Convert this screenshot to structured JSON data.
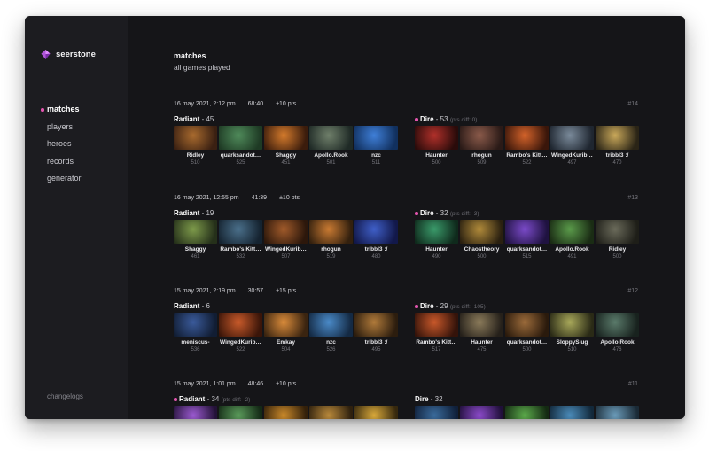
{
  "app": {
    "name": "seerstone",
    "logo": "gem-icon",
    "accent": "#e255ae"
  },
  "sidebar": {
    "items": [
      {
        "label": "matches",
        "active": true
      },
      {
        "label": "players",
        "active": false
      },
      {
        "label": "heroes",
        "active": false
      },
      {
        "label": "records",
        "active": false
      },
      {
        "label": "generator",
        "active": false
      }
    ],
    "footer": "changelogs"
  },
  "page": {
    "title": "matches",
    "subtitle": "all games played"
  },
  "matches": [
    {
      "date": "16 may 2021, 2:12 pm",
      "duration": "68:40",
      "pts": "±10 pts",
      "id": "#14",
      "radiant": {
        "name": "Radiant",
        "score": " - 45",
        "diff": "",
        "winner": false,
        "players": [
          {
            "name": "Ridley",
            "points": "510",
            "hero_colors": [
              "#a86a2e",
              "#3a2012"
            ]
          },
          {
            "name": "quarksandot…",
            "points": "525",
            "hero_colors": [
              "#4f8a5a",
              "#1e3a24"
            ]
          },
          {
            "name": "Shaggy",
            "points": "451",
            "hero_colors": [
              "#d37a2c",
              "#3b1c0c"
            ]
          },
          {
            "name": "Apollo.Rook",
            "points": "501",
            "hero_colors": [
              "#6f7f6a",
              "#1f2a26"
            ]
          },
          {
            "name": "nzc",
            "points": "511",
            "hero_colors": [
              "#3f7fd8",
              "#11305e"
            ]
          }
        ]
      },
      "dire": {
        "name": "Dire",
        "score": " - 53",
        "diff": "(pts diff: 0)",
        "winner": true,
        "players": [
          {
            "name": "Haunter",
            "points": "500",
            "hero_colors": [
              "#b0302a",
              "#2a0b0a"
            ]
          },
          {
            "name": "rhogun",
            "points": "509",
            "hero_colors": [
              "#8a5a4a",
              "#2a1a17"
            ]
          },
          {
            "name": "Rambo's Kitt…",
            "points": "522",
            "hero_colors": [
              "#d2622a",
              "#3a160a"
            ]
          },
          {
            "name": "WingedKurib…",
            "points": "497",
            "hero_colors": [
              "#7a8a9a",
              "#1f2630"
            ]
          },
          {
            "name": "tribbl3 :/",
            "points": "470",
            "hero_colors": [
              "#c9a85a",
              "#2a2416"
            ]
          }
        ]
      }
    },
    {
      "date": "16 may 2021, 12:55 pm",
      "duration": "41:39",
      "pts": "±10 pts",
      "id": "#13",
      "radiant": {
        "name": "Radiant",
        "score": " - 19",
        "diff": "",
        "winner": false,
        "players": [
          {
            "name": "Shaggy",
            "points": "461",
            "hero_colors": [
              "#7d9a4a",
              "#25301a"
            ]
          },
          {
            "name": "Rambo's Kitt…",
            "points": "532",
            "hero_colors": [
              "#4a6f8a",
              "#152330"
            ]
          },
          {
            "name": "WingedKurib…",
            "points": "507",
            "hero_colors": [
              "#a05a2a",
              "#2c170b"
            ]
          },
          {
            "name": "rhogun",
            "points": "519",
            "hero_colors": [
              "#c97a32",
              "#33200e"
            ]
          },
          {
            "name": "tribbl3 :/",
            "points": "480",
            "hero_colors": [
              "#3f5fc8",
              "#12184a"
            ]
          }
        ]
      },
      "dire": {
        "name": "Dire",
        "score": " - 32",
        "diff": "(pts diff: -3)",
        "winner": true,
        "players": [
          {
            "name": "Haunter",
            "points": "490",
            "hero_colors": [
              "#3a9a6a",
              "#0f2a1c"
            ]
          },
          {
            "name": "Chaostheory",
            "points": "500",
            "hero_colors": [
              "#b08a3a",
              "#2a2010"
            ]
          },
          {
            "name": "quarksandot…",
            "points": "515",
            "hero_colors": [
              "#7a4ac8",
              "#1f1240"
            ]
          },
          {
            "name": "Apollo.Rook",
            "points": "491",
            "hero_colors": [
              "#5a9a4a",
              "#1a2c14"
            ]
          },
          {
            "name": "Ridley",
            "points": "500",
            "hero_colors": [
              "#6a6a5a",
              "#1e1e18"
            ]
          }
        ]
      }
    },
    {
      "date": "15 may 2021, 2:19 pm",
      "duration": "30:57",
      "pts": "±15 pts",
      "id": "#12",
      "radiant": {
        "name": "Radiant",
        "score": " - 6",
        "diff": "",
        "winner": false,
        "players": [
          {
            "name": "meniscus-",
            "points": "536",
            "hero_colors": [
              "#3a5a9a",
              "#111d33"
            ]
          },
          {
            "name": "WingedKurib…",
            "points": "522",
            "hero_colors": [
              "#c85a2a",
              "#3a1509"
            ]
          },
          {
            "name": "Emkay",
            "points": "504",
            "hero_colors": [
              "#d88a3a",
              "#3a2410"
            ]
          },
          {
            "name": "nzc",
            "points": "526",
            "hero_colors": [
              "#4a8ac8",
              "#142a44"
            ]
          },
          {
            "name": "tribbl3 :/",
            "points": "495",
            "hero_colors": [
              "#b07a3a",
              "#2c1d0e"
            ]
          }
        ]
      },
      "dire": {
        "name": "Dire",
        "score": " - 29",
        "diff": "(pts diff: -105)",
        "winner": true,
        "players": [
          {
            "name": "Rambo's Kitt…",
            "points": "517",
            "hero_colors": [
              "#c8582a",
              "#34130a"
            ]
          },
          {
            "name": "Haunter",
            "points": "475",
            "hero_colors": [
              "#8a7a5a",
              "#25201a"
            ]
          },
          {
            "name": "quarksandot…",
            "points": "500",
            "hero_colors": [
              "#9a6a3a",
              "#2a1a0c"
            ]
          },
          {
            "name": "SloppySlug",
            "points": "510",
            "hero_colors": [
              "#a8a85a",
              "#2a2a16"
            ]
          },
          {
            "name": "Apollo.Rook",
            "points": "476",
            "hero_colors": [
              "#5a7a6a",
              "#18221e"
            ]
          }
        ]
      }
    },
    {
      "date": "15 may 2021, 1:01 pm",
      "duration": "48:46",
      "pts": "±10 pts",
      "id": "#11",
      "radiant": {
        "name": "Radiant",
        "score": " - 34",
        "diff": "(pts diff: -2)",
        "winner": true,
        "players": [
          {
            "name": "",
            "points": "",
            "hero_colors": [
              "#9a5acf",
              "#241238"
            ]
          },
          {
            "name": "",
            "points": "",
            "hero_colors": [
              "#5a9a5a",
              "#142a16"
            ]
          },
          {
            "name": "",
            "points": "",
            "hero_colors": [
              "#c8882a",
              "#33200a"
            ]
          },
          {
            "name": "",
            "points": "",
            "hero_colors": [
              "#b8883a",
              "#2e200e"
            ]
          },
          {
            "name": "",
            "points": "",
            "hero_colors": [
              "#d8a83a",
              "#36280e"
            ]
          }
        ]
      },
      "dire": {
        "name": "Dire",
        "score": " - 32",
        "diff": "",
        "winner": false,
        "players": [
          {
            "name": "",
            "points": "",
            "hero_colors": [
              "#3a6a9a",
              "#10203a"
            ]
          },
          {
            "name": "",
            "points": "",
            "hero_colors": [
              "#8a4ac8",
              "#200f3a"
            ]
          },
          {
            "name": "",
            "points": "",
            "hero_colors": [
              "#5aa84a",
              "#142a12"
            ]
          },
          {
            "name": "",
            "points": "",
            "hero_colors": [
              "#4a8ab8",
              "#12283a"
            ]
          },
          {
            "name": "",
            "points": "",
            "hero_colors": [
              "#6a9ab8",
              "#1a2a36"
            ]
          }
        ]
      }
    }
  ]
}
